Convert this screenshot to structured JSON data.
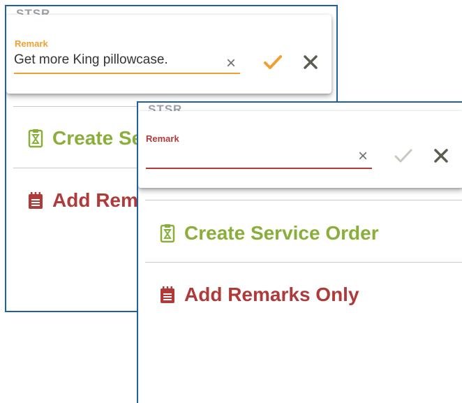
{
  "colors": {
    "panel_border": "#1f5fa8",
    "active_accent": "#f0a030",
    "error_accent": "#b03a3a",
    "service_green": "#8aae3a",
    "remarks_red": "#b03a3a",
    "close_dark": "#5c5c50",
    "confirm_disabled": "#c8c8c0"
  },
  "panels": [
    {
      "code_text": "STSR",
      "remark_field": {
        "label": "Remark",
        "value": "Get more King pillowcase.",
        "state": "focused-valid"
      },
      "confirm_enabled": true,
      "menu": [
        {
          "label": "Create Se",
          "icon": "clipboard-hourglass-icon"
        },
        {
          "label": "Add Rem",
          "icon": "notepad-icon"
        }
      ]
    },
    {
      "code_text": "STSR",
      "remark_field": {
        "label": "Remark",
        "value": "",
        "state": "error-empty"
      },
      "confirm_enabled": false,
      "menu": [
        {
          "label": "Create Service Order",
          "icon": "clipboard-hourglass-icon"
        },
        {
          "label": "Add Remarks Only",
          "icon": "notepad-icon"
        }
      ]
    }
  ]
}
